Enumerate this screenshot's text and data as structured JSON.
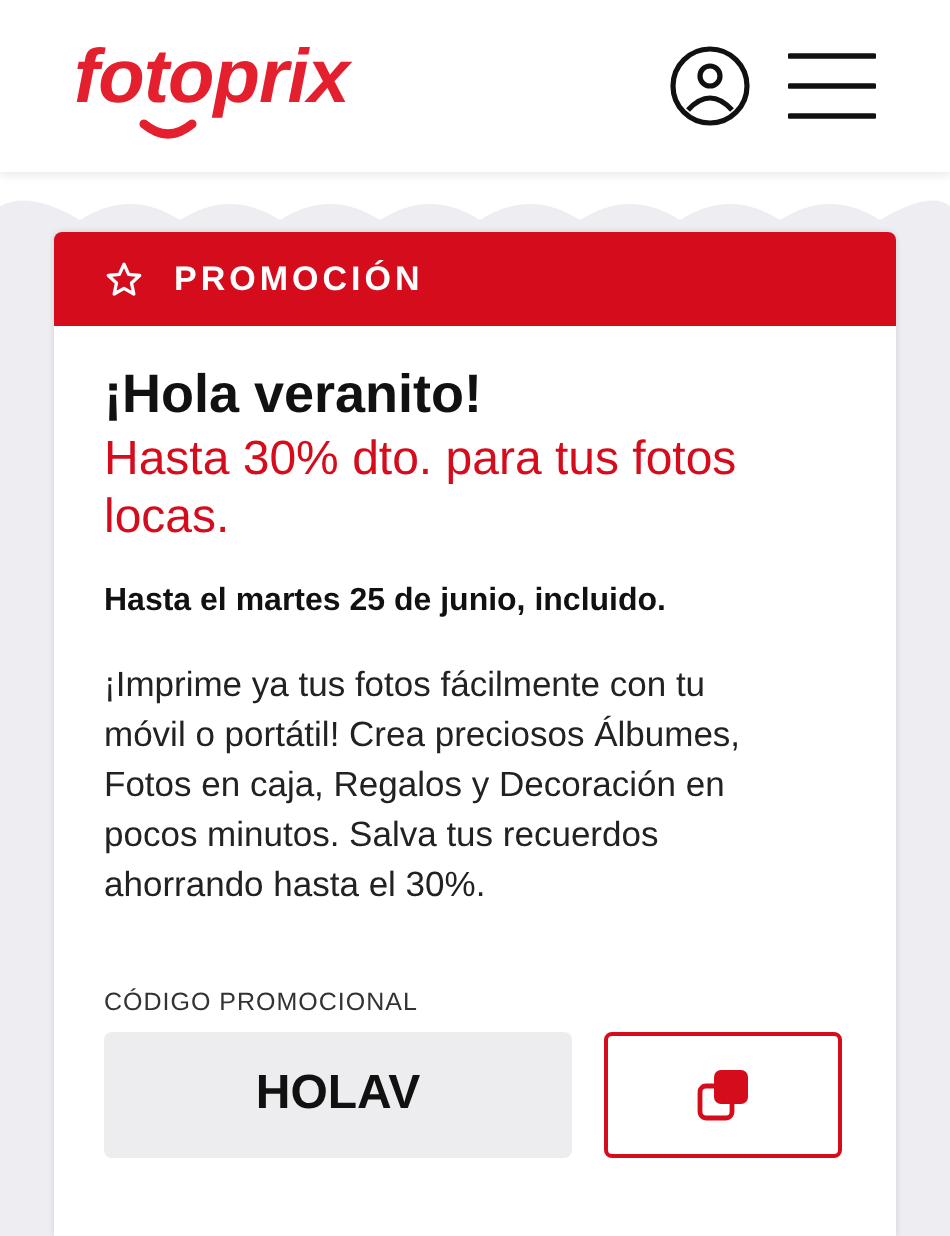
{
  "header": {
    "logo": "fotoprix"
  },
  "promo": {
    "badge": "PROMOCIÓN",
    "title": "¡Hola veranito!",
    "subtitle": "Hasta 30% dto. para tus fotos locas.",
    "deadline": "Hasta el martes 25 de junio, incluido.",
    "description": "¡Imprime ya tus fotos fácilmente con tu móvil o portátil! Crea preciosos Álbumes, Fotos en caja, Regalos y Decoración en pocos minutos. Salva tus recuerdos ahorrando hasta el 30%.",
    "code_label": "CÓDIGO PROMOCIONAL",
    "code": "HOLAV"
  }
}
